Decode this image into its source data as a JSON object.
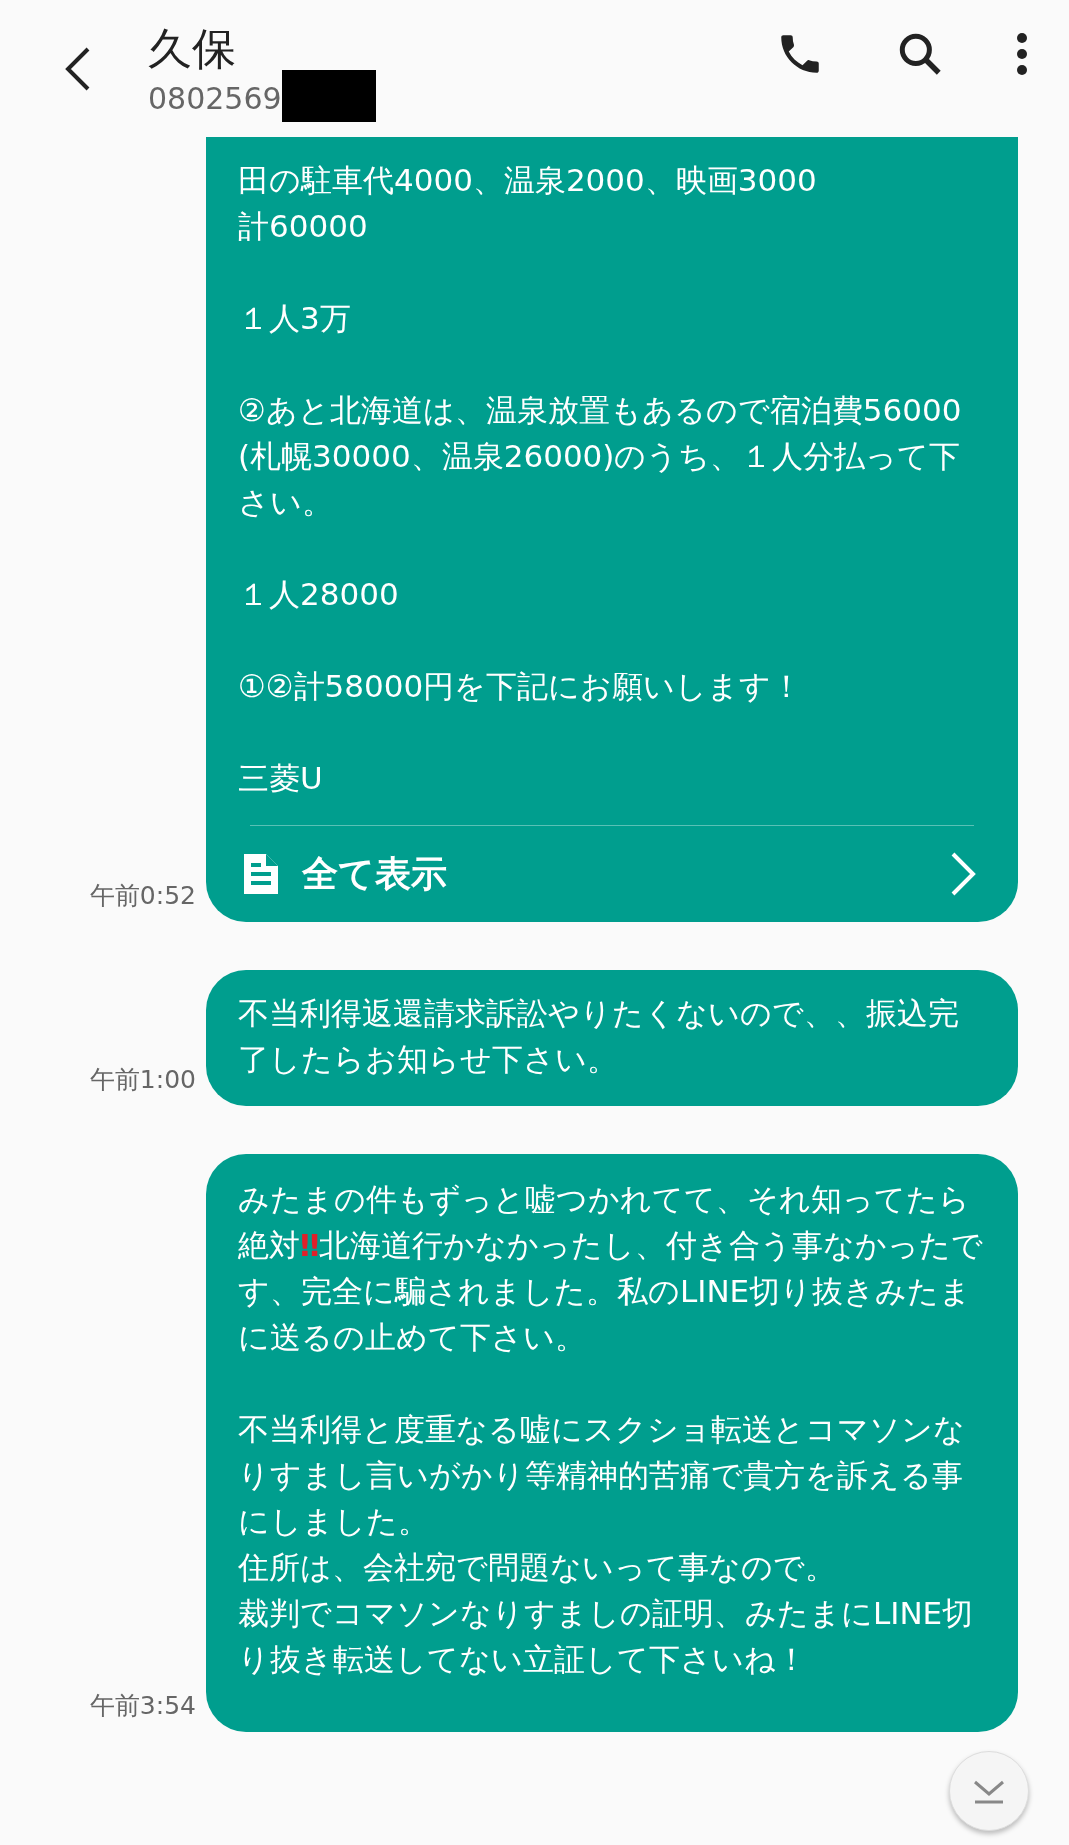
{
  "header": {
    "contact_name": "久保",
    "phone_number": "0802569"
  },
  "messages": [
    {
      "time": "午前0:52",
      "blocks": [
        {
          "lines": [
            {
              "segments": [
                {
                  "kind": "text",
                  "text": "田の駐車代4000、温泉2000、映画3000"
                }
              ]
            },
            {
              "segments": [
                {
                  "kind": "text",
                  "text": "計60000"
                }
              ]
            }
          ]
        },
        {
          "lines": [
            {
              "segments": [
                {
                  "kind": "text",
                  "text": "１人3万"
                }
              ]
            }
          ]
        },
        {
          "lines": [
            {
              "segments": [
                {
                  "kind": "text",
                  "text": "②あと北海道は、温泉放置もあるので宿泊費56000(札幌30000、温泉26000)のうち、１人分払って下さい。"
                }
              ]
            }
          ]
        },
        {
          "lines": [
            {
              "segments": [
                {
                  "kind": "text",
                  "text": "１人28000"
                }
              ]
            }
          ]
        },
        {
          "lines": [
            {
              "segments": [
                {
                  "kind": "text",
                  "text": "①②計58000円を下記にお願いします！"
                }
              ]
            }
          ]
        },
        {
          "lines": [
            {
              "segments": [
                {
                  "kind": "text",
                  "text": "三菱U"
                }
              ]
            }
          ]
        }
      ],
      "footer": {
        "label": "全て表示"
      }
    },
    {
      "time": "午前1:00",
      "blocks": [
        {
          "lines": [
            {
              "segments": [
                {
                  "kind": "text",
                  "text": "不当利得返還請求訴訟やりたくないので、、振込完了したらお知らせ下さい。"
                }
              ]
            }
          ]
        }
      ]
    },
    {
      "time": "午前3:54",
      "blocks": [
        {
          "lines": [
            {
              "segments": [
                {
                  "kind": "text",
                  "text": "みたまの件もずっと嘘つかれてて、それ知ってたら絶対"
                },
                {
                  "kind": "emoji",
                  "text": "‼"
                },
                {
                  "kind": "text",
                  "text": "北海道行かなかったし、付き合う事なかったです、完全に騙されました。私のLINE切り抜きみたまに送るの止めて下さい。"
                }
              ]
            }
          ]
        },
        {
          "lines": [
            {
              "segments": [
                {
                  "kind": "text",
                  "text": "不当利得と度重なる嘘にスクショ転送とコマソンなりすまし言いがかり等精神的苦痛で貴方を訴える事にしました。"
                }
              ]
            },
            {
              "segments": [
                {
                  "kind": "text",
                  "text": "住所は、会社宛で問題ないって事なので。"
                }
              ]
            },
            {
              "segments": [
                {
                  "kind": "text",
                  "text": "裁判でコマソンなりすましの証明、みたまにLINE切り抜き転送してない立証して下さいね！"
                }
              ]
            }
          ]
        }
      ]
    }
  ]
}
